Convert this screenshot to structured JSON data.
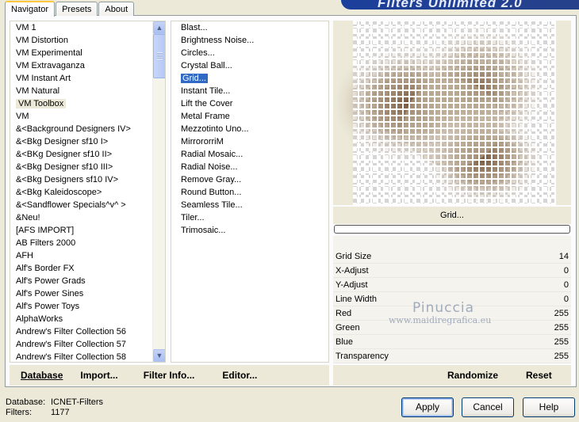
{
  "tabs": [
    "Navigator",
    "Presets",
    "About"
  ],
  "header_title": "Filters Unlimited 2.0",
  "categories": [
    "VM 1",
    "VM Distortion",
    "VM Experimental",
    "VM Extravaganza",
    "VM Instant Art",
    "VM Natural",
    "VM Toolbox",
    "VM",
    "&<Background Designers IV>",
    "&<Bkg Designer sf10 I>",
    "&<BKg Designer sf10 II>",
    "&<Bkg Designer sf10 III>",
    "&<Bkg Designers sf10 IV>",
    "&<Bkg Kaleidoscope>",
    "&<Sandflower Specials^v^ >",
    "&Neu!",
    "[AFS IMPORT]",
    "AB Filters 2000",
    "AFH",
    "Alf's Border FX",
    "Alf's Power Grads",
    "Alf's Power Sines",
    "Alf's Power Toys",
    "AlphaWorks",
    "Andrew's Filter Collection 56",
    "Andrew's Filter Collection 57",
    "Andrew's Filter Collection 58"
  ],
  "selected_category": "VM Toolbox",
  "filters": [
    "Blast...",
    "Brightness Noise...",
    "Circles...",
    "Crystal Ball...",
    "Grid...",
    "Instant Tile...",
    "Lift the Cover",
    "Metal Frame",
    "Mezzotinto Uno...",
    "MirrororriM",
    "Radial Mosaic...",
    "Radial Noise...",
    "Remove Gray...",
    "Round Button...",
    "Seamless Tile...",
    "Tiler...",
    "Trimosaic..."
  ],
  "selected_filter": "Grid...",
  "left_buttons": {
    "database": "Database",
    "import": "Import...",
    "filter_info": "Filter Info...",
    "editor": "Editor..."
  },
  "preview_filter_name": "Grid...",
  "params": [
    {
      "name": "Grid Size",
      "value": "14"
    },
    {
      "name": "X-Adjust",
      "value": "0"
    },
    {
      "name": "Y-Adjust",
      "value": "0"
    },
    {
      "name": "Line Width",
      "value": "0"
    },
    {
      "name": "Red",
      "value": "255"
    },
    {
      "name": "Green",
      "value": "255"
    },
    {
      "name": "Blue",
      "value": "255"
    },
    {
      "name": "Transparency",
      "value": "255"
    }
  ],
  "watermark": {
    "line1": "Pinuccia",
    "line2": "www.maidiregrafica.eu"
  },
  "right_buttons": {
    "randomize": "Randomize",
    "reset": "Reset"
  },
  "status": {
    "database_label": "Database:",
    "database_value": "ICNET-Filters",
    "filters_label": "Filters:",
    "filters_value": "1177"
  },
  "dialog_buttons": {
    "apply": "Apply",
    "cancel": "Cancel",
    "help": "Help"
  },
  "colors": {
    "selection": "#316ac5",
    "panel": "#ece9d8",
    "header": "#1b3f9c"
  }
}
